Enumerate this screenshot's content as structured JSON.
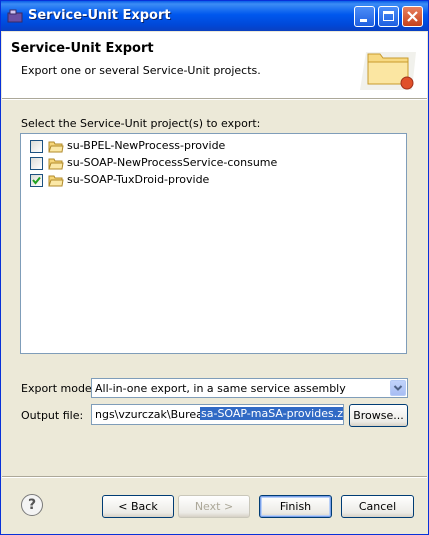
{
  "window": {
    "title": "Service-Unit Export"
  },
  "header": {
    "title": "Service-Unit Export",
    "description": "Export one or several Service-Unit projects."
  },
  "projects": {
    "label": "Select the Service-Unit project(s) to export:",
    "items": [
      {
        "label": "su-BPEL-NewProcess-provide",
        "checked": false
      },
      {
        "label": "su-SOAP-NewProcessService-consume",
        "checked": false
      },
      {
        "label": "su-SOAP-TuxDroid-provide",
        "checked": true
      }
    ]
  },
  "export_mode": {
    "label": "Export mode:",
    "value": "All-in-one export, in a same service assembly"
  },
  "output_file": {
    "label": "Output file:",
    "value_plain": "ngs\\vzurczak\\Bureau\\",
    "value_selected": "sa-SOAP-maSA-provides.zip",
    "browse_label": "Browse..."
  },
  "footer": {
    "help_label": "?",
    "back_label": "< Back",
    "next_label": "Next >",
    "finish_label": "Finish",
    "cancel_label": "Cancel"
  }
}
